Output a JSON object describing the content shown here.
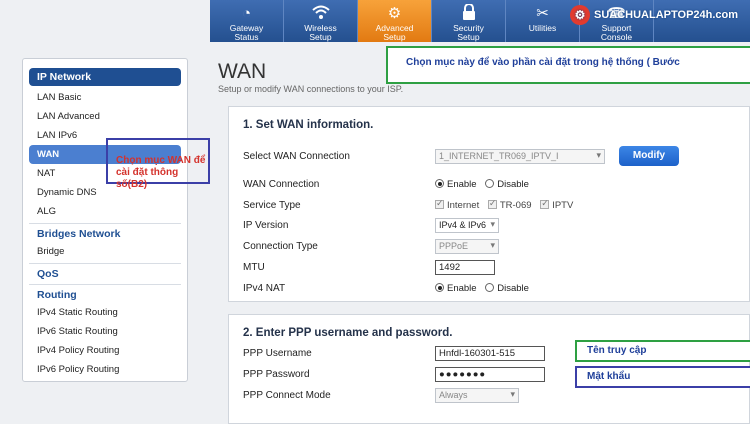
{
  "nav": {
    "tabs": [
      {
        "line1": "Gateway",
        "line2": "Status",
        "icon": "gateway-icon"
      },
      {
        "line1": "Wireless",
        "line2": "Setup",
        "icon": "wifi-icon"
      },
      {
        "line1": "Advanced",
        "line2": "Setup",
        "icon": "gear-icon",
        "active": true
      },
      {
        "line1": "Security",
        "line2": "Setup",
        "icon": "lock-icon"
      },
      {
        "line1": "Utilities",
        "line2": "",
        "icon": "tools-icon"
      },
      {
        "line1": "Support",
        "line2": "Console",
        "icon": "support-icon"
      }
    ],
    "logo": "SUACHUALAPTOP24h.com"
  },
  "sidebar": {
    "header": "IP Network",
    "items": [
      "LAN Basic",
      "LAN Advanced",
      "LAN IPv6",
      "WAN",
      "NAT",
      "Dynamic DNS",
      "ALG"
    ],
    "active": "WAN",
    "groups": [
      {
        "title": "Bridges Network",
        "items": [
          "Bridge"
        ]
      },
      {
        "title": "QoS",
        "items": []
      },
      {
        "title": "Routing",
        "items": [
          "IPv4 Static Routing",
          "IPv6 Static Routing",
          "IPv4 Policy Routing",
          "IPv6 Policy Routing"
        ]
      }
    ]
  },
  "main": {
    "title": "WAN",
    "subtitle": "Setup or modify WAN connections to your ISP.",
    "section1": {
      "heading": "1. Set WAN information.",
      "select_wan_label": "Select WAN Connection",
      "select_wan_value": "1_INTERNET_TR069_IPTV_I",
      "modify_label": "Modify",
      "wan_connection_label": "WAN Connection",
      "enable_label": "Enable",
      "disable_label": "Disable",
      "service_type_label": "Service Type",
      "service_internet": "Internet",
      "service_tr069": "TR-069",
      "service_iptv": "IPTV",
      "ip_version_label": "IP Version",
      "ip_version_value": "IPv4 & IPv6",
      "connection_type_label": "Connection Type",
      "connection_type_value": "PPPoE",
      "mtu_label": "MTU",
      "mtu_value": "1492",
      "ipv4_nat_label": "IPv4 NAT"
    },
    "section2": {
      "heading": "2. Enter PPP username and password.",
      "username_label": "PPP Username",
      "username_value": "Hnfdl-160301-515",
      "password_label": "PPP Password",
      "password_value": "●●●●●●●",
      "connect_mode_label": "PPP Connect Mode",
      "connect_mode_value": "Always"
    }
  },
  "annotations": {
    "system": "Chọn mục này để vào phần cài đặt trong hệ thống ( Bước",
    "wan_line1": "Chọn mục WAN để",
    "wan_line2": "cài đặt thông số(B2)",
    "username": "Tên truy cập",
    "password": "Mật khẩu"
  }
}
